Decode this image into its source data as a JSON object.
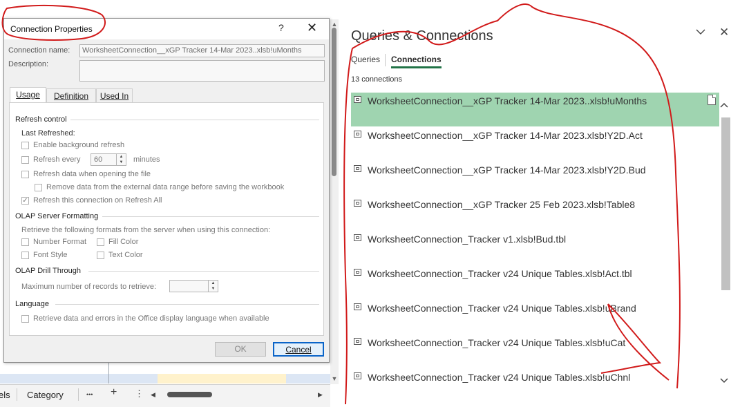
{
  "excel": {
    "sheet_tab_partial": "els",
    "sheet_tab": "Category",
    "more_label": "•••",
    "add_label": "+",
    "menu_label": "⋮",
    "scroll_left": "◀",
    "scroll_right": "▶"
  },
  "dialog": {
    "title": "Connection Properties",
    "help_label": "?",
    "close_label": "✕",
    "connection_name_label": "Connection name:",
    "connection_name_value": "WorksheetConnection__xGP Tracker 14-Mar 2023..xlsb!uMonths",
    "description_label": "Description:",
    "description_value": "",
    "tabs": [
      {
        "label": "Usage",
        "active": true
      },
      {
        "label": "Definition",
        "active": false
      },
      {
        "label": "Used In",
        "active": false
      }
    ],
    "refresh_control": {
      "heading": "Refresh control",
      "last_refreshed_label": "Last Refreshed:",
      "enable_background": "Enable background refresh",
      "refresh_every": "Refresh every",
      "refresh_every_value": "60",
      "minutes_label": "minutes",
      "refresh_on_open": "Refresh data when opening the file",
      "remove_data": "Remove data from the external data range before saving the workbook",
      "refresh_all": "Refresh this connection on Refresh All",
      "refresh_all_checked": true
    },
    "olap_formatting": {
      "heading": "OLAP Server Formatting",
      "description": "Retrieve the following formats from the server when using this connection:",
      "number_format": "Number Format",
      "fill_color": "Fill Color",
      "font_style": "Font Style",
      "text_color": "Text Color"
    },
    "olap_drill": {
      "heading": "OLAP Drill Through",
      "max_records_label": "Maximum number of records to retrieve:",
      "max_records_value": ""
    },
    "language": {
      "heading": "Language",
      "retrieve_label": "Retrieve data and errors in the Office display language when available"
    },
    "ok_label": "OK",
    "cancel_label": "Cancel"
  },
  "queries_pane": {
    "title": "Queries & Connections",
    "collapse_icon": "chevron-down-icon",
    "close_label": "✕",
    "tabs": [
      {
        "label": "Queries",
        "active": false
      },
      {
        "label": "Connections",
        "active": true
      }
    ],
    "count_label": "13 connections",
    "accent_color": "#217346",
    "selected_color": "#9fd4b0",
    "connections": [
      {
        "name": "WorksheetConnection__xGP Tracker 14-Mar 2023..xlsb!uMonths",
        "selected": true
      },
      {
        "name": "WorksheetConnection__xGP Tracker 14-Mar 2023.xlsb!Y2D.Act",
        "selected": false
      },
      {
        "name": "WorksheetConnection__xGP Tracker 14-Mar 2023.xlsb!Y2D.Bud",
        "selected": false
      },
      {
        "name": "WorksheetConnection__xGP Tracker 25 Feb 2023.xlsb!Table8",
        "selected": false
      },
      {
        "name": "WorksheetConnection_Tracker v1.xlsb!Bud.tbl",
        "selected": false
      },
      {
        "name": "WorksheetConnection_Tracker v24 Unique Tables.xlsb!Act.tbl",
        "selected": false
      },
      {
        "name": "WorksheetConnection_Tracker v24 Unique Tables.xlsb!uBrand",
        "selected": false
      },
      {
        "name": "WorksheetConnection_Tracker v24 Unique Tables.xlsb!uCat",
        "selected": false
      },
      {
        "name": "WorksheetConnection_Tracker v24 Unique Tables.xlsb!uChnl",
        "selected": false
      }
    ]
  },
  "annotation_color": "#d11a1a"
}
